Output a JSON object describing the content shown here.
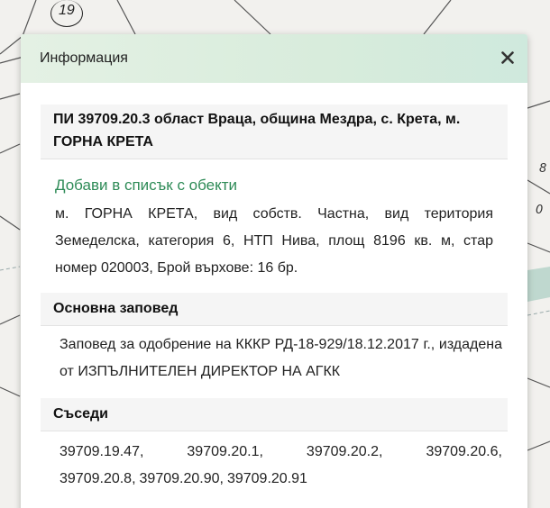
{
  "map": {
    "parcel_labels": [
      "19",
      "8",
      "0"
    ]
  },
  "dialog": {
    "title": "Информация",
    "parcel_title": "ПИ 39709.20.3 област Враца, община Мездра, с. Крета, м. ГОРНА КРЕТА",
    "add_link": "Добави в списък с обекти",
    "description": "м. ГОРНА КРЕТА, вид собств. Частна, вид територия Земеделска, категория 6, НТП Нива, площ 8196 кв. м, стар номер 020003, Брой върхове: 16 бр.",
    "order_header": "Основна заповед",
    "order_text": "Заповед за одобрение на КККР РД-18-929/18.12.2017 г., издадена от ИЗПЪЛНИТЕЛЕН ДИРЕКТОР НА АГКК",
    "neighbors_header": "Съседи",
    "neighbors": [
      "39709.19.47,",
      "39709.20.1,",
      "39709.20.2,",
      "39709.20.6,",
      "39709.20.8,",
      "39709.20.90,",
      "39709.20.91"
    ]
  }
}
